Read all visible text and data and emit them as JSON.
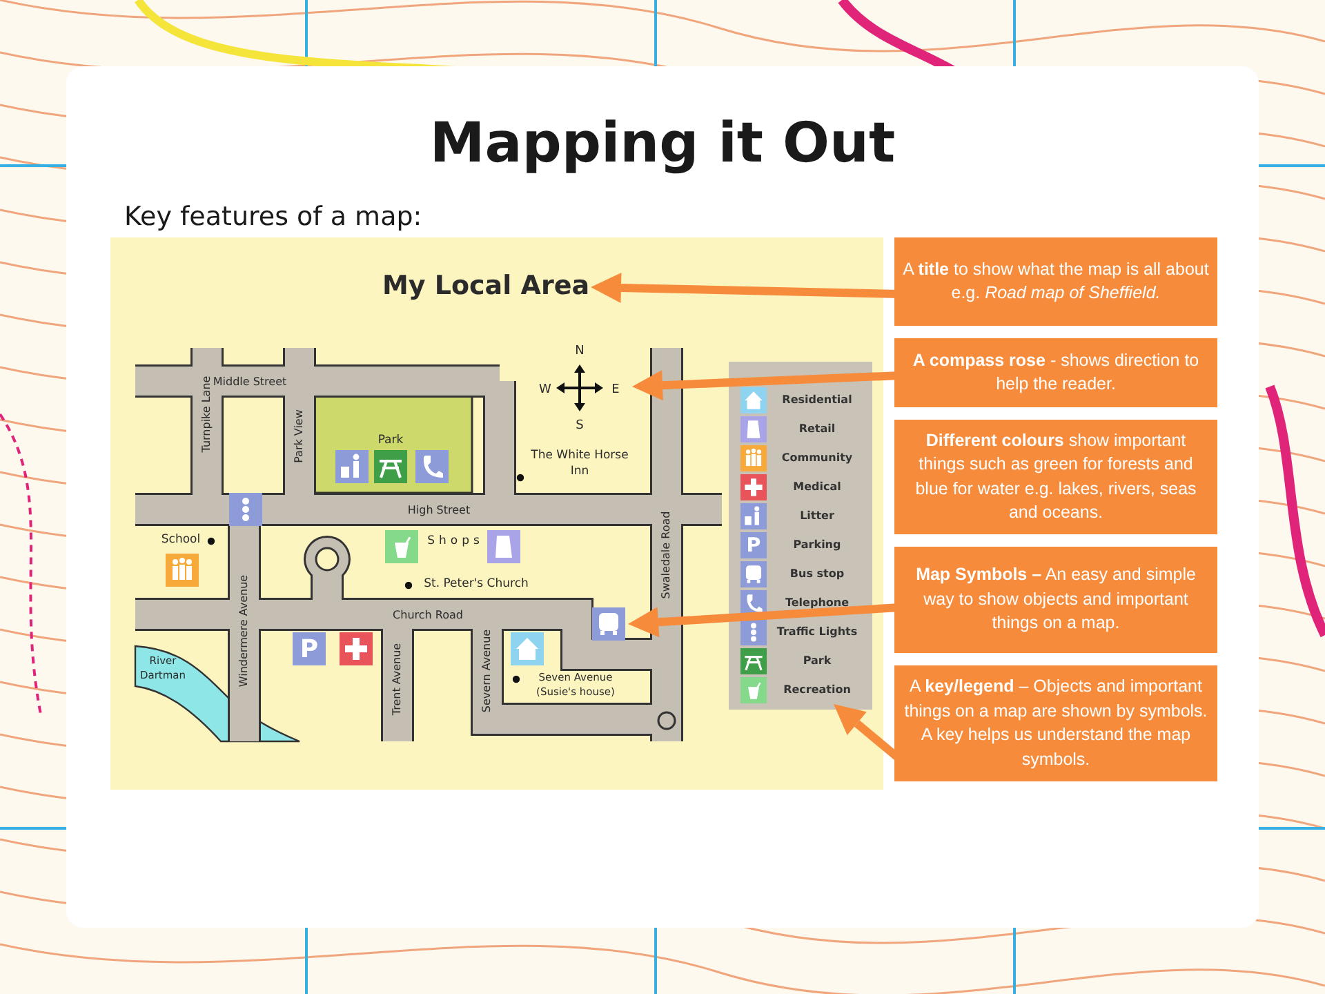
{
  "slide": {
    "title": "Mapping it Out",
    "subtitle": "Key features of a map:"
  },
  "map": {
    "title": "My Local Area",
    "compass": {
      "north": "N",
      "east": "E",
      "south": "S",
      "west": "W"
    },
    "street_labels": [
      "Middle Street",
      "Turnpike Lane",
      "Park View",
      "High Street",
      "Church Road",
      "Windermere Avenue",
      "Trent Avenue",
      "Severn Avenue",
      "Swaledale Road"
    ],
    "place_labels": [
      {
        "lines": [
          "Park"
        ]
      },
      {
        "lines": [
          "School"
        ]
      },
      {
        "lines": [
          "Shops"
        ]
      },
      {
        "lines": [
          "St. Peter's Church"
        ]
      },
      {
        "lines": [
          "The White Horse",
          "Inn"
        ]
      },
      {
        "lines": [
          "Seven Avenue",
          "(Susie's house)"
        ]
      },
      {
        "lines": [
          "River",
          "Dartman"
        ]
      }
    ],
    "symbols": [
      {
        "kind": "litter"
      },
      {
        "kind": "park"
      },
      {
        "kind": "telephone"
      },
      {
        "kind": "traffic"
      },
      {
        "kind": "community"
      },
      {
        "kind": "recreation"
      },
      {
        "kind": "retail"
      },
      {
        "kind": "parking",
        "glyph": "P"
      },
      {
        "kind": "medical"
      },
      {
        "kind": "residential"
      },
      {
        "kind": "bus"
      }
    ],
    "legend": [
      {
        "kind": "residential",
        "label": "Residential"
      },
      {
        "kind": "retail",
        "label": "Retail"
      },
      {
        "kind": "community",
        "label": "Community"
      },
      {
        "kind": "medical",
        "label": "Medical"
      },
      {
        "kind": "litter",
        "label": "Litter"
      },
      {
        "kind": "parking",
        "label": "Parking",
        "glyph": "P"
      },
      {
        "kind": "bus",
        "label": "Bus stop"
      },
      {
        "kind": "telephone",
        "label": "Telephone"
      },
      {
        "kind": "traffic",
        "label": "Traffic Lights"
      },
      {
        "kind": "park",
        "label": "Park"
      },
      {
        "kind": "recreation",
        "label": "Recreation"
      }
    ]
  },
  "callouts": [
    {
      "text": "A **title** to show what the map is all about e.g. *Road map of Sheffield.*"
    },
    {
      "text": "**A compass rose** -  shows direction to help the reader."
    },
    {
      "text": "**Different colours** show important things such as green for forests and blue for water e.g. lakes, rivers, seas and oceans."
    },
    {
      "text": "**Map Symbols –** An easy and simple way to show objects and important things on a map."
    },
    {
      "text": "A **key/legend** – Objects and important things on a map are shown by symbols. A key helps us understand the map symbols."
    }
  ]
}
